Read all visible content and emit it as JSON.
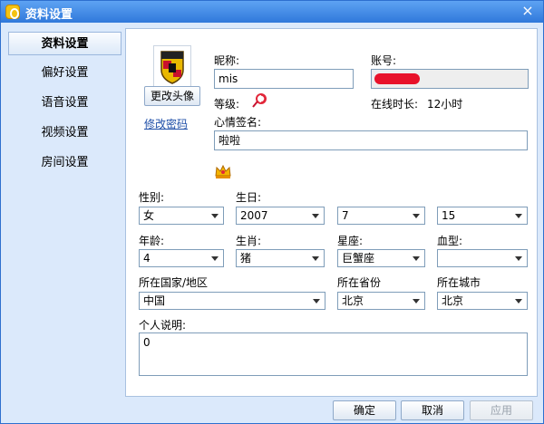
{
  "window": {
    "title": "资料设置",
    "close_glyph": "×"
  },
  "sidebar": {
    "items": [
      {
        "label": "资料设置",
        "active": true
      },
      {
        "label": "偏好设置"
      },
      {
        "label": "语音设置"
      },
      {
        "label": "视频设置"
      },
      {
        "label": "房间设置"
      }
    ]
  },
  "profile": {
    "change_avatar_label": "更改头像",
    "change_password_label": "修改密码",
    "nickname_label": "昵称:",
    "nickname_value": "mis",
    "account_label": "账号:",
    "level_label": "等级:",
    "online_label": "在线时长:",
    "online_value": "12小时",
    "signature_label": "心情签名:",
    "signature_value": "啦啦",
    "gender_label": "性别:",
    "gender_value": "女",
    "birthday_label": "生日:",
    "birth_year": "2007",
    "birth_month": "7",
    "birth_day": "15",
    "age_label": "年龄:",
    "age_value": "4",
    "zodiac_label": "生肖:",
    "zodiac_value": "猪",
    "constellation_label": "星座:",
    "constellation_value": "巨蟹座",
    "blood_label": "血型:",
    "blood_value": "",
    "country_label": "所在国家/地区",
    "country_value": "中国",
    "province_label": "所在省份",
    "province_value": "北京",
    "city_label": "所在城市",
    "city_value": "北京",
    "intro_label": "个人说明:",
    "intro_value": "0"
  },
  "buttons": {
    "ok": "确定",
    "cancel": "取消",
    "apply": "应用"
  },
  "icons": {
    "app": "app-logo-icon",
    "level": "level-lollipop-icon",
    "crown": "crown-icon"
  },
  "colors": {
    "titlebar": "#2f78db",
    "redaction": "#e8122a",
    "link": "#1f4fa8"
  }
}
